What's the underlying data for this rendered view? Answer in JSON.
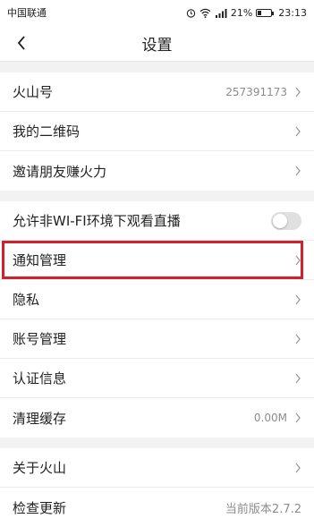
{
  "status_bar": {
    "carrier": "中国联通",
    "signal_text": "4G",
    "battery": "21%",
    "time": "23:13"
  },
  "nav": {
    "title": "设置"
  },
  "group1": {
    "items": [
      {
        "label": "火山号",
        "value": "257391173"
      },
      {
        "label": "我的二维码"
      },
      {
        "label": "邀请朋友赚火力"
      }
    ]
  },
  "group2": {
    "items": [
      {
        "label": "允许非WI-FI环境下观看直播",
        "toggle": false
      },
      {
        "label": "通知管理"
      },
      {
        "label": "隐私"
      },
      {
        "label": "账号管理"
      },
      {
        "label": "认证信息"
      },
      {
        "label": "清理缓存",
        "value": "0.00M"
      }
    ]
  },
  "group3": {
    "items": [
      {
        "label": "关于火山"
      },
      {
        "label": "检查更新",
        "value": "当前版本2.7.2"
      }
    ]
  },
  "colors": {
    "highlight": "#d3202f",
    "value_text": "#8c8c8c"
  }
}
